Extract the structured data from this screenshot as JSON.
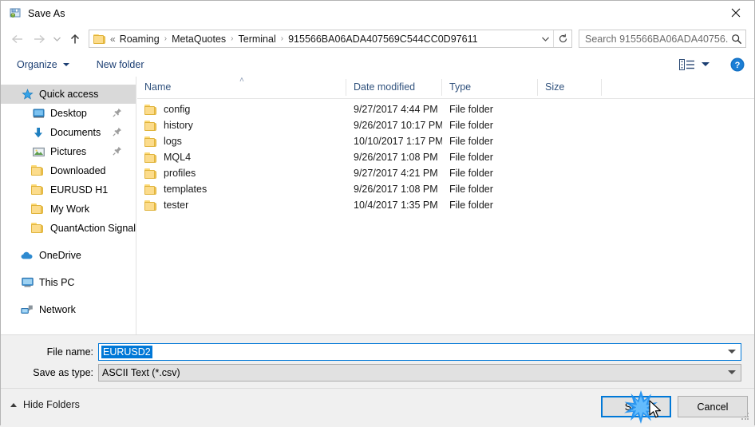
{
  "window": {
    "title": "Save As",
    "icon": "save-as-app-icon",
    "close_label": "✕"
  },
  "navigation": {
    "back_icon": "back-arrow-icon",
    "forward_icon": "forward-arrow-icon",
    "recent_icon": "recent-locations-chevron-icon",
    "up_icon": "up-arrow-icon"
  },
  "address_bar": {
    "folder_icon": "folder-icon",
    "overflow": "«",
    "separator": "›",
    "crumbs": [
      "Roaming",
      "MetaQuotes",
      "Terminal",
      "915566BA06ADA407569C544CC0D97611"
    ],
    "dropdown_icon": "chevron-down-icon",
    "refresh_icon": "refresh-icon"
  },
  "search": {
    "placeholder": "Search 915566BA06ADA40756...",
    "icon": "search-icon"
  },
  "toolbar": {
    "organize_label": "Organize",
    "new_folder_label": "New folder",
    "view_icon": "view-layout-icon",
    "view_caret_icon": "chevron-down-icon",
    "help_icon": "help-question-icon",
    "help_label": "?"
  },
  "sidebar": {
    "items": [
      {
        "label": "Quick access",
        "icon": "star-icon",
        "level": 0,
        "selected": true,
        "pinned": false
      },
      {
        "label": "Desktop",
        "icon": "desktop-monitor-icon",
        "level": 1,
        "selected": false,
        "pinned": true
      },
      {
        "label": "Documents",
        "icon": "documents-download-arrow-icon",
        "level": 1,
        "selected": false,
        "pinned": true
      },
      {
        "label": "Pictures",
        "icon": "pictures-image-icon",
        "level": 1,
        "selected": false,
        "pinned": true
      },
      {
        "label": "Downloaded",
        "icon": "folder-icon",
        "level": 1,
        "selected": false,
        "pinned": false
      },
      {
        "label": "EURUSD H1",
        "icon": "folder-icon",
        "level": 1,
        "selected": false,
        "pinned": false
      },
      {
        "label": "My Work",
        "icon": "folder-icon",
        "level": 1,
        "selected": false,
        "pinned": false
      },
      {
        "label": "QuantAction Signal",
        "icon": "folder-icon",
        "level": 1,
        "selected": false,
        "pinned": false
      },
      {
        "label": "OneDrive",
        "icon": "onedrive-cloud-icon",
        "level": 0,
        "selected": false,
        "pinned": false,
        "gap_before": true
      },
      {
        "label": "This PC",
        "icon": "this-pc-monitor-icon",
        "level": 0,
        "selected": false,
        "pinned": false,
        "gap_before": true
      },
      {
        "label": "Network",
        "icon": "network-icon",
        "level": 0,
        "selected": false,
        "pinned": false,
        "gap_before": true
      }
    ]
  },
  "file_list": {
    "columns": [
      "Name",
      "Date modified",
      "Type",
      "Size"
    ],
    "sort_indicator": "˄",
    "rows": [
      {
        "name": "config",
        "date": "9/27/2017 4:44 PM",
        "type": "File folder",
        "size": "",
        "icon": "folder-icon"
      },
      {
        "name": "history",
        "date": "9/26/2017 10:17 PM",
        "type": "File folder",
        "size": "",
        "icon": "folder-icon"
      },
      {
        "name": "logs",
        "date": "10/10/2017 1:17 PM",
        "type": "File folder",
        "size": "",
        "icon": "folder-icon"
      },
      {
        "name": "MQL4",
        "date": "9/26/2017 1:08 PM",
        "type": "File folder",
        "size": "",
        "icon": "folder-icon"
      },
      {
        "name": "profiles",
        "date": "9/27/2017 4:21 PM",
        "type": "File folder",
        "size": "",
        "icon": "folder-icon"
      },
      {
        "name": "templates",
        "date": "9/26/2017 1:08 PM",
        "type": "File folder",
        "size": "",
        "icon": "folder-icon"
      },
      {
        "name": "tester",
        "date": "10/4/2017 1:35 PM",
        "type": "File folder",
        "size": "",
        "icon": "folder-icon"
      }
    ]
  },
  "form": {
    "file_name_label": "File name:",
    "file_name_value": "EURUSD2",
    "save_as_type_label": "Save as type:",
    "save_as_type_value": "ASCII Text (*.csv)",
    "dropdown_icon": "chevron-down-icon"
  },
  "footer": {
    "hide_folders_label": "Hide Folders",
    "hide_folders_icon": "chevron-up-icon",
    "save_label": "Save",
    "cancel_label": "Cancel"
  },
  "colors": {
    "accent": "#0078d7",
    "header_text": "#31527d",
    "toolbar_link": "#1c3f73",
    "folder_fill": "#fcdc8c",
    "selection": "#d9d9d9"
  }
}
